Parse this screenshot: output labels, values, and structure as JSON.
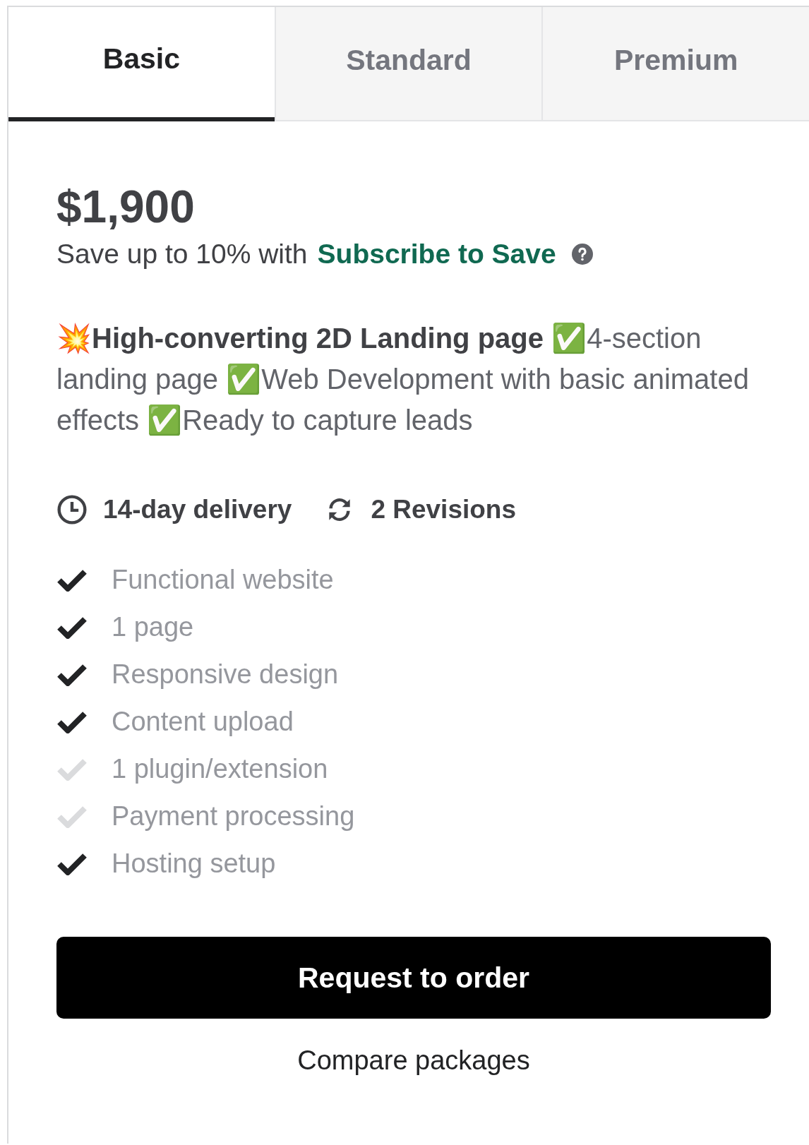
{
  "tabs": [
    {
      "label": "Basic",
      "selected": true
    },
    {
      "label": "Standard",
      "selected": false
    },
    {
      "label": "Premium",
      "selected": false
    }
  ],
  "price": "$1,900",
  "subscribe": {
    "text": "Save up to 10% with",
    "link": "Subscribe to Save"
  },
  "description": "💥**High-converting 2D Landing page** ✅4-section landing page ✅Web Development with basic animated effects ✅Ready to capture leads",
  "delivery": "14-day delivery",
  "revisions": "2 Revisions",
  "features": [
    {
      "label": "Functional website",
      "included": true
    },
    {
      "label": "1 page",
      "included": true
    },
    {
      "label": "Responsive design",
      "included": true
    },
    {
      "label": "Content upload",
      "included": true
    },
    {
      "label": "1 plugin/extension",
      "included": false
    },
    {
      "label": "Payment processing",
      "included": false
    },
    {
      "label": "Hosting setup",
      "included": true
    }
  ],
  "order_button": "Request to order",
  "compare_link": "Compare packages"
}
